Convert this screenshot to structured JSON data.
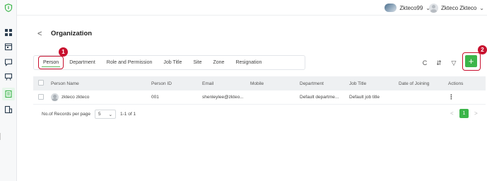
{
  "topbar": {
    "user1": "Zkteco99",
    "user2": "Zkteco Zkteco"
  },
  "page": {
    "back_symbol": "<",
    "title": "Organization"
  },
  "tabs": [
    {
      "label": "Person"
    },
    {
      "label": "Department"
    },
    {
      "label": "Role and Permission"
    },
    {
      "label": "Job Title"
    },
    {
      "label": "Site"
    },
    {
      "label": "Zone"
    },
    {
      "label": "Resignation"
    }
  ],
  "annotations": {
    "badge1": "1",
    "badge2": "2"
  },
  "toolbar": {
    "refresh_icon": "C",
    "import_icon": "⇵",
    "filter_icon": "▽",
    "add_label": "+"
  },
  "table": {
    "headers": [
      "Person Name",
      "Person ID",
      "Email",
      "Mobile",
      "Department",
      "Job Title",
      "Date of Joining",
      "Actions"
    ],
    "rows": [
      {
        "name": "zkteco zkteco",
        "id": "001",
        "email": "shenleylee@zkteo...",
        "mobile": "",
        "department": "Default departme...",
        "job_title": "Default job title",
        "date_of_joining": "",
        "actions": "⋮"
      }
    ]
  },
  "pagination": {
    "label": "No.of Records per page",
    "per_page": "5",
    "range": "1-1 of 1",
    "current_page": "1",
    "prev": "<",
    "next": ">"
  },
  "colors": {
    "accent": "#3cb54a",
    "highlight": "#c8102e"
  }
}
